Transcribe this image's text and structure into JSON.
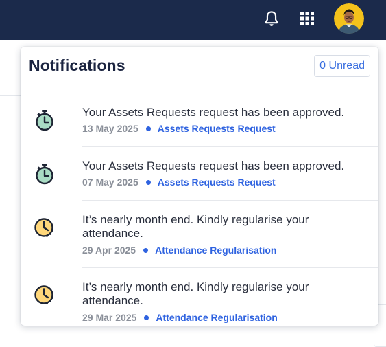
{
  "colors": {
    "topbar_bg": "#1b2a4b",
    "accent": "#2f63e0",
    "title": "#1b2440",
    "muted": "#8a8f99",
    "timer_green": "#a9dcc4",
    "clock_yellow": "#ffd77a"
  },
  "header": {
    "icons": [
      "bell-icon",
      "apps-grid-icon",
      "user-avatar"
    ]
  },
  "notifications": {
    "title": "Notifications",
    "unread_label": "0 Unread",
    "items": [
      {
        "icon": "stopwatch-icon",
        "text": "Your Assets Requests request has been approved.",
        "date": "13 May 2025",
        "category": "Assets Requests Request"
      },
      {
        "icon": "stopwatch-icon",
        "text": "Your Assets Requests request has been approved.",
        "date": "07 May 2025",
        "category": "Assets Requests Request"
      },
      {
        "icon": "clock-icon",
        "text": "It’s nearly month end. Kindly regularise your attendance.",
        "date": "29 Apr 2025",
        "category": "Attendance Regularisation"
      },
      {
        "icon": "clock-icon",
        "text": "It’s nearly month end. Kindly regularise your attendance.",
        "date": "29 Mar 2025",
        "category": "Attendance Regularisation"
      }
    ]
  }
}
